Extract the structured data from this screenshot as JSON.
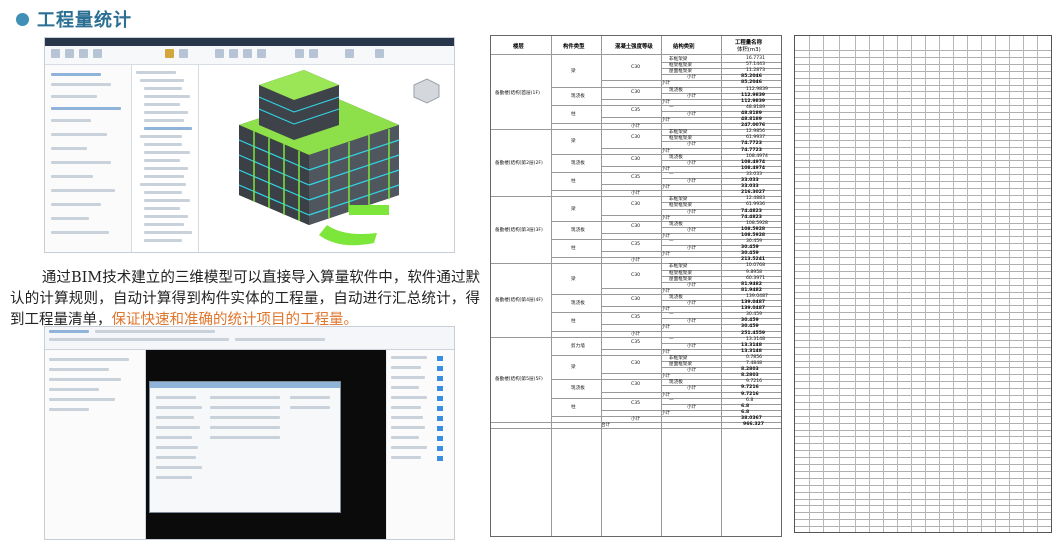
{
  "title": "工程量统计",
  "paragraph": {
    "text": "通过BIM技术建立的三维模型可以直接导入算量软件中，软件通过默认的计算规则，自动计算得到构件实体的工程量，自动进行汇总统计，得到工程量清单，",
    "highlight": "保证快速和准确的统计项目的工程量。"
  },
  "table": {
    "headers": {
      "floor": "楼层",
      "component": "构件类型",
      "grade": "混凝土强度等级",
      "structure": "结构类别",
      "quantity": "工程量名称",
      "volume": "体积(m3)"
    },
    "rows": [
      {
        "floor": "备勤楼[结构]首层(1F)",
        "component": "梁",
        "grade": "C30",
        "items": [
          {
            "name": "非框架梁",
            "value": "16.7731"
          },
          {
            "name": "框架框架梁",
            "value": "57.1443"
          },
          {
            "name": "屋面框架梁",
            "value": "11.2873"
          }
        ],
        "subtotal": "85.2046",
        "grade_total": "85.2046"
      },
      {
        "floor": "",
        "component": "现浇板",
        "grade": "C30",
        "items": [
          {
            "name": "现浇板",
            "value": "112.9839"
          }
        ],
        "subtotal": "112.9839",
        "grade_total": "112.9839"
      },
      {
        "floor": "",
        "component": "柱",
        "grade": "C35",
        "items": [
          {
            "name": "—",
            "value": "48.8189"
          }
        ],
        "subtotal": "48.8189",
        "grade_total": "48.8189"
      },
      {
        "floor": "",
        "component": "",
        "grade": "",
        "items": [],
        "subtotal": "",
        "grade_total": "247.0076"
      },
      {
        "floor": "备勤楼[结构]第2层(2F)",
        "component": "梁",
        "grade": "C30",
        "items": [
          {
            "name": "非框架梁",
            "value": "12.9856"
          },
          {
            "name": "框架框架梁",
            "value": "61.9937"
          }
        ],
        "subtotal": "74.7723",
        "grade_total": "74.7723"
      },
      {
        "floor": "",
        "component": "现浇板",
        "grade": "C30",
        "items": [
          {
            "name": "现浇板",
            "value": "108.4974"
          }
        ],
        "subtotal": "108.4974",
        "grade_total": "108.4974"
      },
      {
        "floor": "",
        "component": "柱",
        "grade": "C35",
        "items": [
          {
            "name": "—",
            "value": "33.033"
          }
        ],
        "subtotal": "33.033",
        "grade_total": "33.033"
      },
      {
        "floor": "",
        "component": "",
        "grade": "",
        "items": [],
        "subtotal": "",
        "grade_total": "216.3027"
      },
      {
        "floor": "备勤楼[结构]第3层(3F)",
        "component": "梁",
        "grade": "C30",
        "items": [
          {
            "name": "非框架梁",
            "value": "12.4883"
          },
          {
            "name": "框架框架梁",
            "value": "61.9936"
          }
        ],
        "subtotal": "74.4823",
        "grade_total": "74.4823"
      },
      {
        "floor": "",
        "component": "现浇板",
        "grade": "C30",
        "items": [
          {
            "name": "现浇板",
            "value": "108.5928"
          }
        ],
        "subtotal": "108.5928",
        "grade_total": "108.5928"
      },
      {
        "floor": "",
        "component": "柱",
        "grade": "C35",
        "items": [
          {
            "name": "—",
            "value": "30.459"
          }
        ],
        "subtotal": "30.459",
        "grade_total": "30.459"
      },
      {
        "floor": "",
        "component": "",
        "grade": "",
        "items": [],
        "subtotal": "",
        "grade_total": "213.5241"
      },
      {
        "floor": "备勤楼[结构]第4层(4F)",
        "component": "梁",
        "grade": "C30",
        "items": [
          {
            "name": "非框架梁",
            "value": "10.0768"
          },
          {
            "name": "框架框架梁",
            "value": "9.8958"
          },
          {
            "name": "屋面框架梁",
            "value": "60.3971"
          }
        ],
        "subtotal": "81.9482",
        "grade_total": "81.9482"
      },
      {
        "floor": "",
        "component": "现浇板",
        "grade": "C30",
        "items": [
          {
            "name": "现浇板",
            "value": "139.0487"
          }
        ],
        "subtotal": "139.0487",
        "grade_total": "139.0487"
      },
      {
        "floor": "",
        "component": "柱",
        "grade": "C35",
        "items": [
          {
            "name": "—",
            "value": "30.459"
          }
        ],
        "subtotal": "30.459",
        "grade_total": "30.459"
      },
      {
        "floor": "",
        "component": "",
        "grade": "",
        "items": [],
        "subtotal": "",
        "grade_total": "251.4559"
      },
      {
        "floor": "备勤楼[结构]第5层(5F)",
        "component": "剪力墙",
        "grade": "C35",
        "items": [
          {
            "name": "—",
            "value": "13.3148"
          }
        ],
        "subtotal": "13.3148",
        "grade_total": "13.3148"
      },
      {
        "floor": "",
        "component": "梁",
        "grade": "C30",
        "items": [
          {
            "name": "非框架梁",
            "value": "0.7856"
          },
          {
            "name": "屋面框架梁",
            "value": "7.4848"
          }
        ],
        "subtotal": "8.2803",
        "grade_total": "8.2803"
      },
      {
        "floor": "",
        "component": "现浇板",
        "grade": "C30",
        "items": [
          {
            "name": "现浇板",
            "value": "9.7216"
          }
        ],
        "subtotal": "9.7216",
        "grade_total": "9.7216"
      },
      {
        "floor": "",
        "component": "柱",
        "grade": "C35",
        "items": [
          {
            "name": "—",
            "value": "6.8"
          }
        ],
        "subtotal": "6.8",
        "grade_total": "6.8"
      },
      {
        "floor": "",
        "component": "",
        "grade": "",
        "items": [],
        "subtotal": "",
        "grade_total": "38.0367"
      }
    ],
    "subtotal_label": "小计",
    "grand_total_label": "合计",
    "grand_total": "966.327"
  },
  "colors": {
    "title": "#2b6f93",
    "bullet": "#3f8fb6",
    "highlight": "#e0752c",
    "model_green": "#7de63a",
    "model_cyan": "#31d6e8"
  }
}
